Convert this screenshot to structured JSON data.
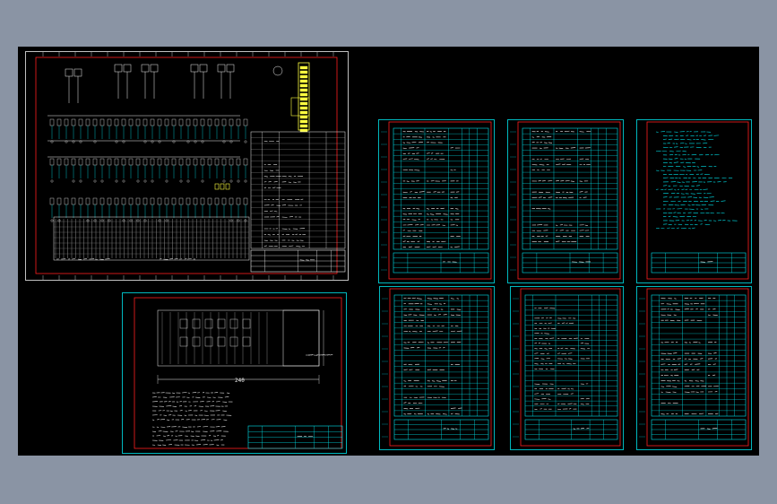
{
  "viewport": {
    "background": "#8a94a4",
    "canvas_background": "#000000"
  },
  "colors": {
    "cyan": "#00e5ee",
    "red": "#ff2020",
    "white": "#f0f0f0",
    "yellow": "#ffff40"
  },
  "sheets": [
    {
      "id": "main-schematic",
      "kind": "schematic",
      "dims": "",
      "title_block": ""
    },
    {
      "id": "panel-layout",
      "kind": "layout",
      "dims": "240",
      "title_block": ""
    },
    {
      "id": "bom-1",
      "kind": "table",
      "title_block": ""
    },
    {
      "id": "bom-2",
      "kind": "table",
      "title_block": ""
    },
    {
      "id": "notes",
      "kind": "notes",
      "title_block": ""
    },
    {
      "id": "bom-3",
      "kind": "table",
      "title_block": ""
    },
    {
      "id": "bom-4",
      "kind": "table",
      "title_block": ""
    },
    {
      "id": "bom-5",
      "kind": "table",
      "title_block": ""
    }
  ]
}
